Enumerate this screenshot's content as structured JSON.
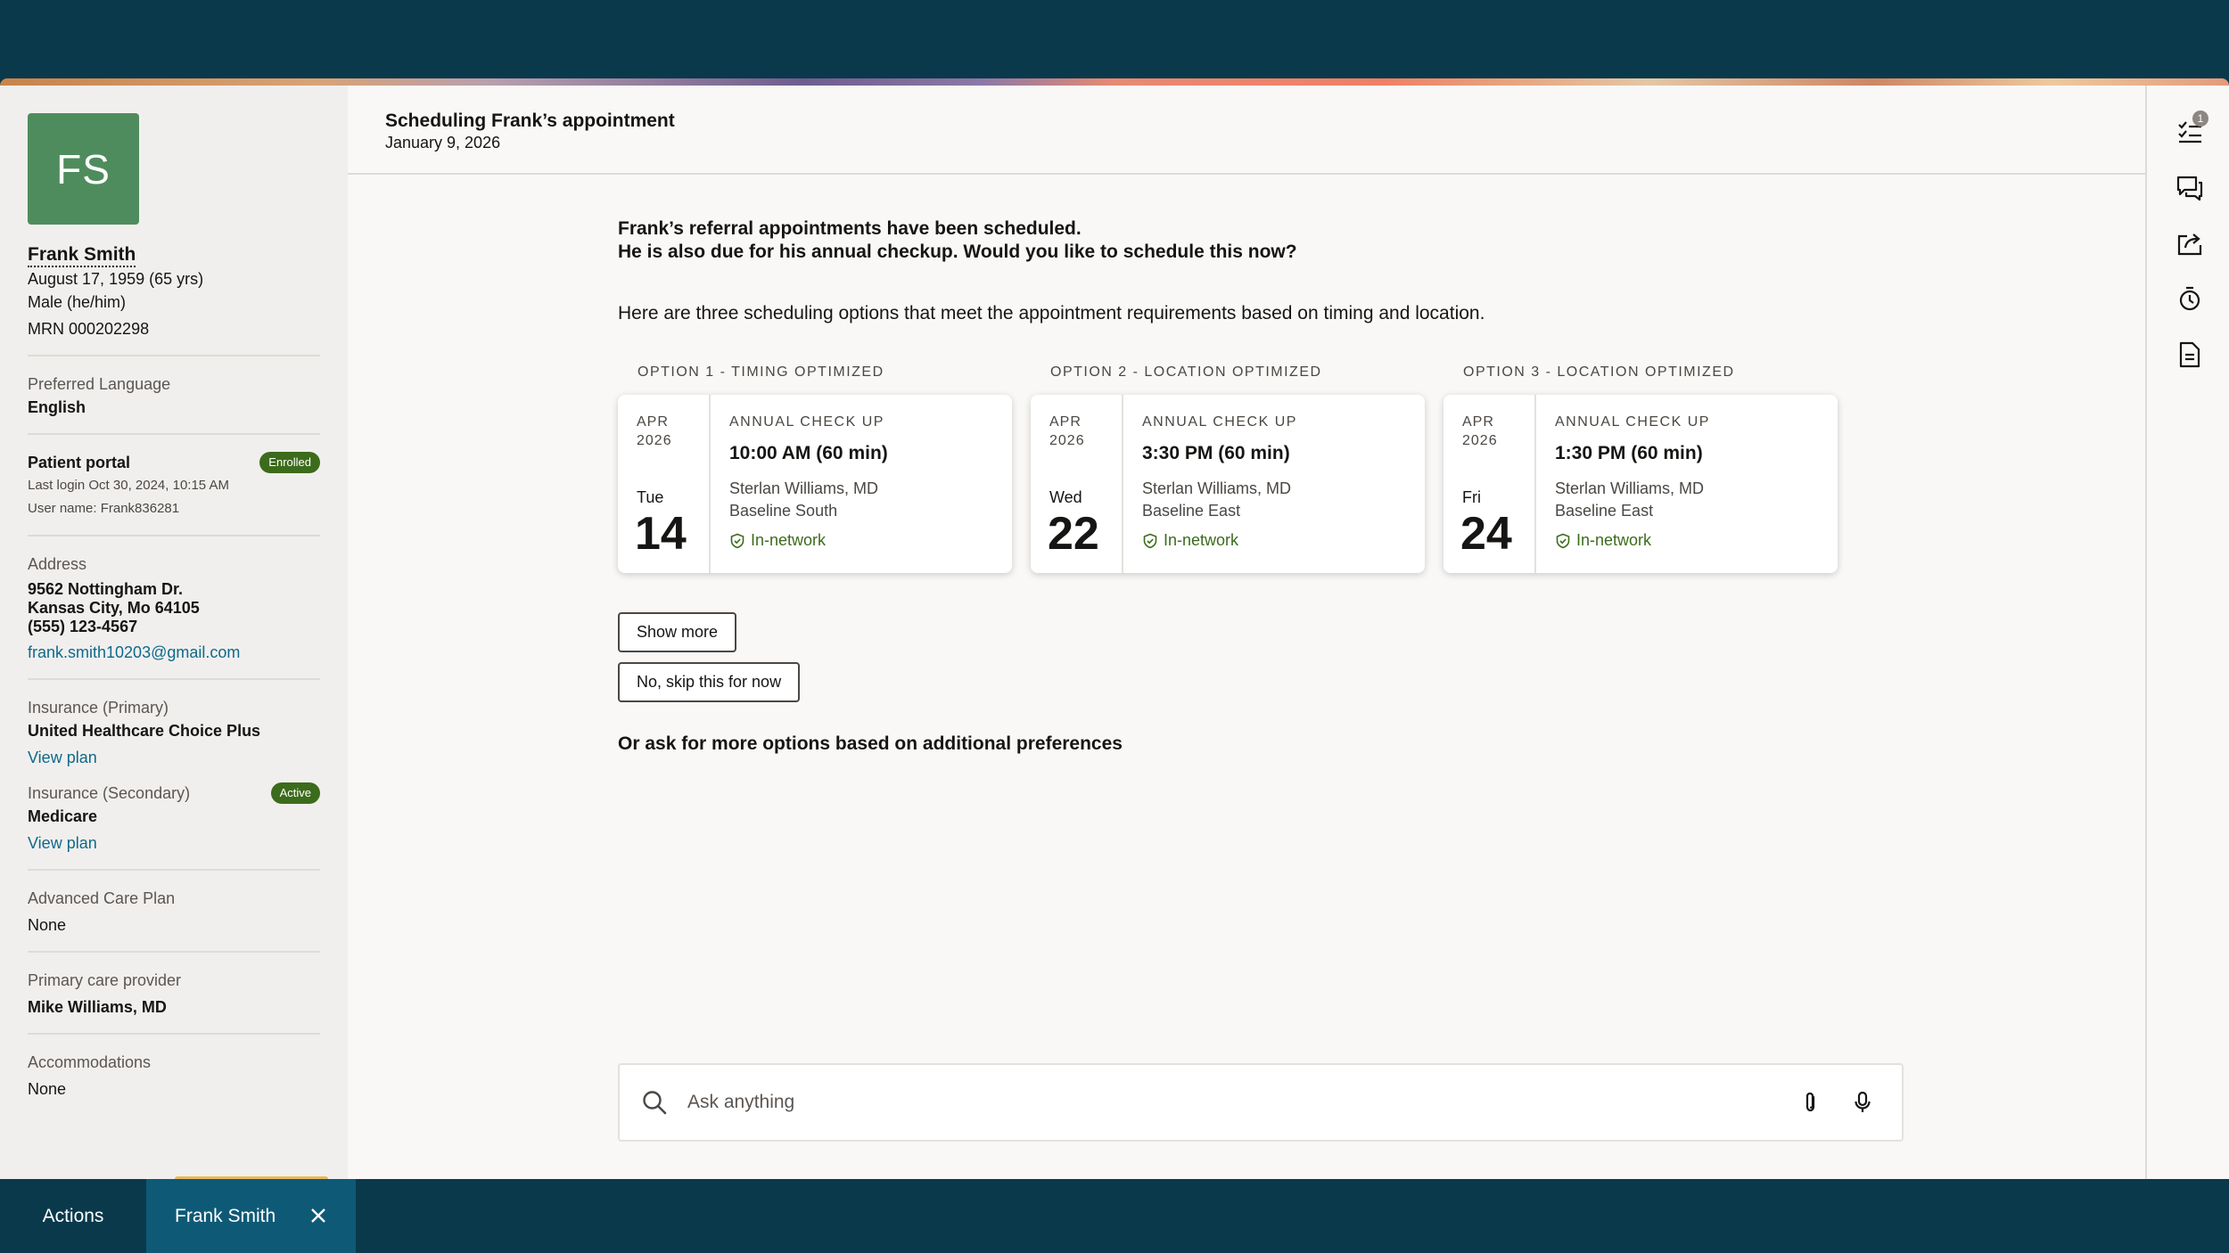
{
  "patient": {
    "initials": "FS",
    "name": "Frank Smith",
    "dob": "August 17, 1959 (65 yrs)",
    "sex": "Male (he/him)",
    "mrn": "MRN 000202298"
  },
  "language": {
    "label": "Preferred Language",
    "value": "English"
  },
  "portal": {
    "label": "Patient portal",
    "badge": "Enrolled",
    "last_login": "Last login Oct 30, 2024, 10:15 AM",
    "username": "User name: Frank836281"
  },
  "address": {
    "label": "Address",
    "line1": "9562 Nottingham Dr.",
    "line2": "Kansas City, Mo 64105",
    "phone": "(555) 123-4567",
    "email": "frank.smith10203@gmail.com"
  },
  "insurance_primary": {
    "label": "Insurance (Primary)",
    "value": "United Healthcare Choice Plus",
    "link": "View plan"
  },
  "insurance_secondary": {
    "label": "Insurance (Secondary)",
    "badge": "Active",
    "value": "Medicare",
    "link": "View plan"
  },
  "care_plan": {
    "label": "Advanced Care Plan",
    "value": "None"
  },
  "pcp": {
    "label": "Primary care provider",
    "value": "Mike Williams, MD"
  },
  "accommodations": {
    "label": "Accommodations",
    "value": "None"
  },
  "header": {
    "title": "Scheduling Frank’s appointment",
    "date": "January 9, 2026"
  },
  "message": {
    "line1": "Frank’s referral appointments have been scheduled.",
    "line2": "He is also due for his annual checkup. Would you like to schedule this now?",
    "description": "Here are three scheduling options that meet the appointment requirements based on timing and location."
  },
  "options": [
    {
      "heading": "OPTION 1 - TIMING OPTIMIZED",
      "month": "APR",
      "year": "2026",
      "dow": "Tue",
      "day": "14",
      "type": "ANNUAL CHECK UP",
      "time": "10:00 AM (60 min)",
      "provider": "Sterlan Williams, MD",
      "location": "Baseline South",
      "network": "In-network"
    },
    {
      "heading": "OPTION 2 - LOCATION OPTIMIZED",
      "month": "APR",
      "year": "2026",
      "dow": "Wed",
      "day": "22",
      "type": "ANNUAL CHECK UP",
      "time": "3:30 PM (60 min)",
      "provider": "Sterlan Williams, MD",
      "location": "Baseline East",
      "network": "In-network"
    },
    {
      "heading": "OPTION 3 - LOCATION OPTIMIZED",
      "month": "APR",
      "year": "2026",
      "dow": "Fri",
      "day": "24",
      "type": "ANNUAL CHECK UP",
      "time": "1:30 PM (60 min)",
      "provider": "Sterlan Williams, MD",
      "location": "Baseline East",
      "network": "In-network"
    }
  ],
  "buttons": {
    "show_more": "Show more",
    "skip": "No, skip this for now"
  },
  "ask_more": "Or ask for more options based on additional preferences",
  "askbar": {
    "placeholder": "Ask anything"
  },
  "rail": {
    "tasks_count": "1"
  },
  "bottombar": {
    "actions": "Actions",
    "tab": "Frank Smith"
  },
  "colors": {
    "brand_dark": "#0a394c",
    "avatar": "#4f8c5d",
    "success": "#3c6b1c",
    "link": "#0d6a8c",
    "tab_active": "#0e5a76"
  },
  "icons": [
    "search-icon",
    "paperclip-icon",
    "microphone-icon",
    "checklist-icon",
    "chat-icon",
    "share-icon",
    "timer-icon",
    "document-icon",
    "close-icon",
    "shield-check-icon"
  ]
}
